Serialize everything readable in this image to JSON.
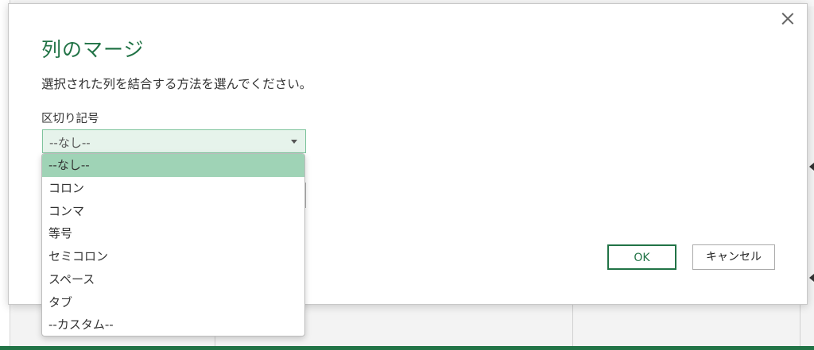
{
  "dialog": {
    "title": "列のマージ",
    "description": "選択された列を結合する方法を選んでください。",
    "separator_label": "区切り記号",
    "separator_value": "--なし--",
    "ok_label": "OK",
    "cancel_label": "キャンセル"
  },
  "dropdown": {
    "options": [
      "--なし--",
      "コロン",
      "コンマ",
      "等号",
      "セミコロン",
      "スペース",
      "タブ",
      "--カスタム--"
    ],
    "selected_index": 0
  },
  "colors": {
    "accent": "#217346",
    "selected_bg": "#9fd3b6",
    "select_bg": "#e6f3eb"
  }
}
